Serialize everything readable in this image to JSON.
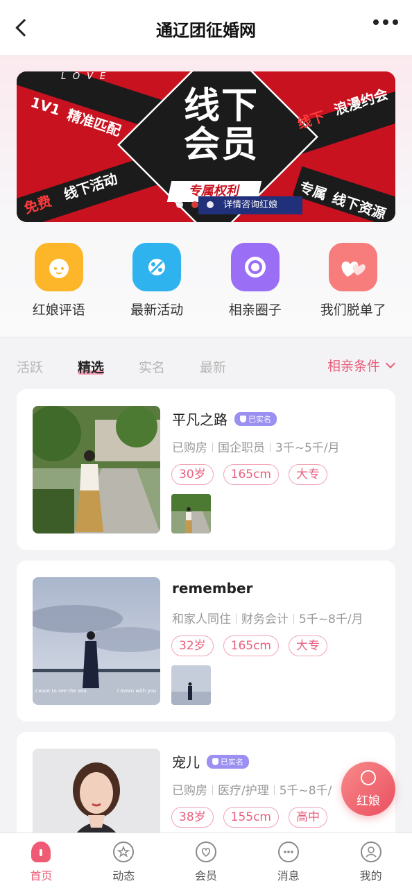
{
  "header": {
    "title": "通辽团征婚网"
  },
  "banner": {
    "love": "LOVE",
    "tag_1v1": "1V1",
    "tag_match": "精准匹配",
    "tag_free": "免费",
    "tag_offline_activity": "线下活动",
    "main_line1": "线下",
    "main_line2": "会员",
    "privilege": "专属权利",
    "consult": "详情咨询红娘",
    "tag_offline": "线下",
    "tag_romance": "浪漫约会",
    "tag_exclusive": "专属",
    "tag_resources": "线下资源"
  },
  "quick": [
    {
      "label": "红娘评语",
      "icon": "matchmaker-icon",
      "color": "#fdb62a"
    },
    {
      "label": "最新活动",
      "icon": "activity-icon",
      "color": "#2fb3ee"
    },
    {
      "label": "相亲圈子",
      "icon": "circle-icon",
      "color": "#9b6ff5"
    },
    {
      "label": "我们脱单了",
      "icon": "hearts-icon",
      "color": "#f77c7c"
    }
  ],
  "tabs": [
    "活跃",
    "精选",
    "实名",
    "最新"
  ],
  "active_tab": "精选",
  "filter_label": "相亲条件",
  "profiles": [
    {
      "name": "平凡之路",
      "verified": "已实名",
      "housing": "已购房",
      "job": "国企职员",
      "income": "3千~5千/月",
      "age": "30岁",
      "height": "165cm",
      "education": "大专"
    },
    {
      "name": "remember",
      "housing": "和家人同住",
      "job": "财务会计",
      "income": "5千~8千/月",
      "age": "32岁",
      "height": "165cm",
      "education": "大专",
      "photo_caption_left": "I want to see the sea.",
      "photo_caption_right": "I mean with you"
    },
    {
      "name": "宠儿",
      "verified": "已实名",
      "housing": "已购房",
      "job": "医疗/护理",
      "income": "5千~8千/",
      "age": "38岁",
      "height": "155cm",
      "education": "高中"
    }
  ],
  "float_button": {
    "label": "红娘"
  },
  "tabbar": [
    {
      "label": "首页",
      "icon": "home-icon"
    },
    {
      "label": "动态",
      "icon": "star-icon"
    },
    {
      "label": "会员",
      "icon": "heart-icon"
    },
    {
      "label": "消息",
      "icon": "message-icon"
    },
    {
      "label": "我的",
      "icon": "user-icon"
    }
  ],
  "colors": {
    "accent": "#ef5a74",
    "banner_red": "#c9121f",
    "verified": "#9b8ff2"
  }
}
